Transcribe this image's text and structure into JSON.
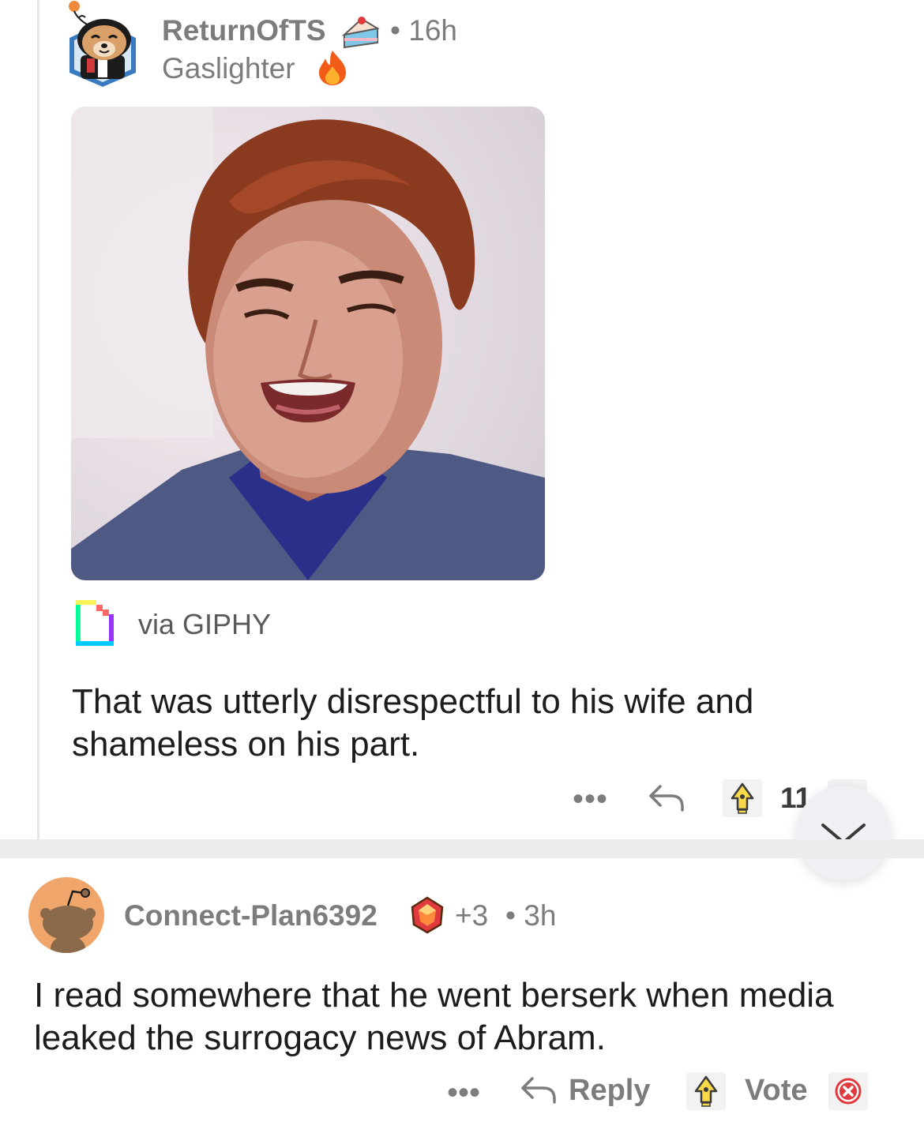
{
  "comments": [
    {
      "username": "ReturnOfTS",
      "separator": "•",
      "time": "16h",
      "flair": "Gaslighter",
      "media_caption": "via GIPHY",
      "body_line1": "That was utterly disrespectful to his wife and",
      "body_line2": "shameless on his part.",
      "score": "11",
      "more_label": "•••"
    },
    {
      "username": "Connect-Plan6392",
      "award_count": "+3",
      "separator": "•",
      "time": "3h",
      "body_line1": "I read somewhere that he went berserk when media",
      "body_line2": "leaked the surrogacy news of Abram.",
      "more_label": "•••",
      "reply_label": "Reply",
      "vote_label": "Vote"
    }
  ],
  "icons": {
    "avatar1": "snoo-avatar-icon",
    "cake_award": "cake-award-icon",
    "flair_fire": "fire-icon",
    "giphy": "giphy-logo-icon",
    "reply": "reply-arrow-icon",
    "upvote": "upvote-icon",
    "downvote": "downvote-icon",
    "collapse": "chevron-down-icon",
    "gem_award": "gem-award-icon"
  },
  "colors": {
    "meta_text": "#7c7c7c",
    "body_text": "#1c1c1c",
    "thread_line": "#e6e6e9",
    "avatar2_bg": "#f0a66b"
  }
}
